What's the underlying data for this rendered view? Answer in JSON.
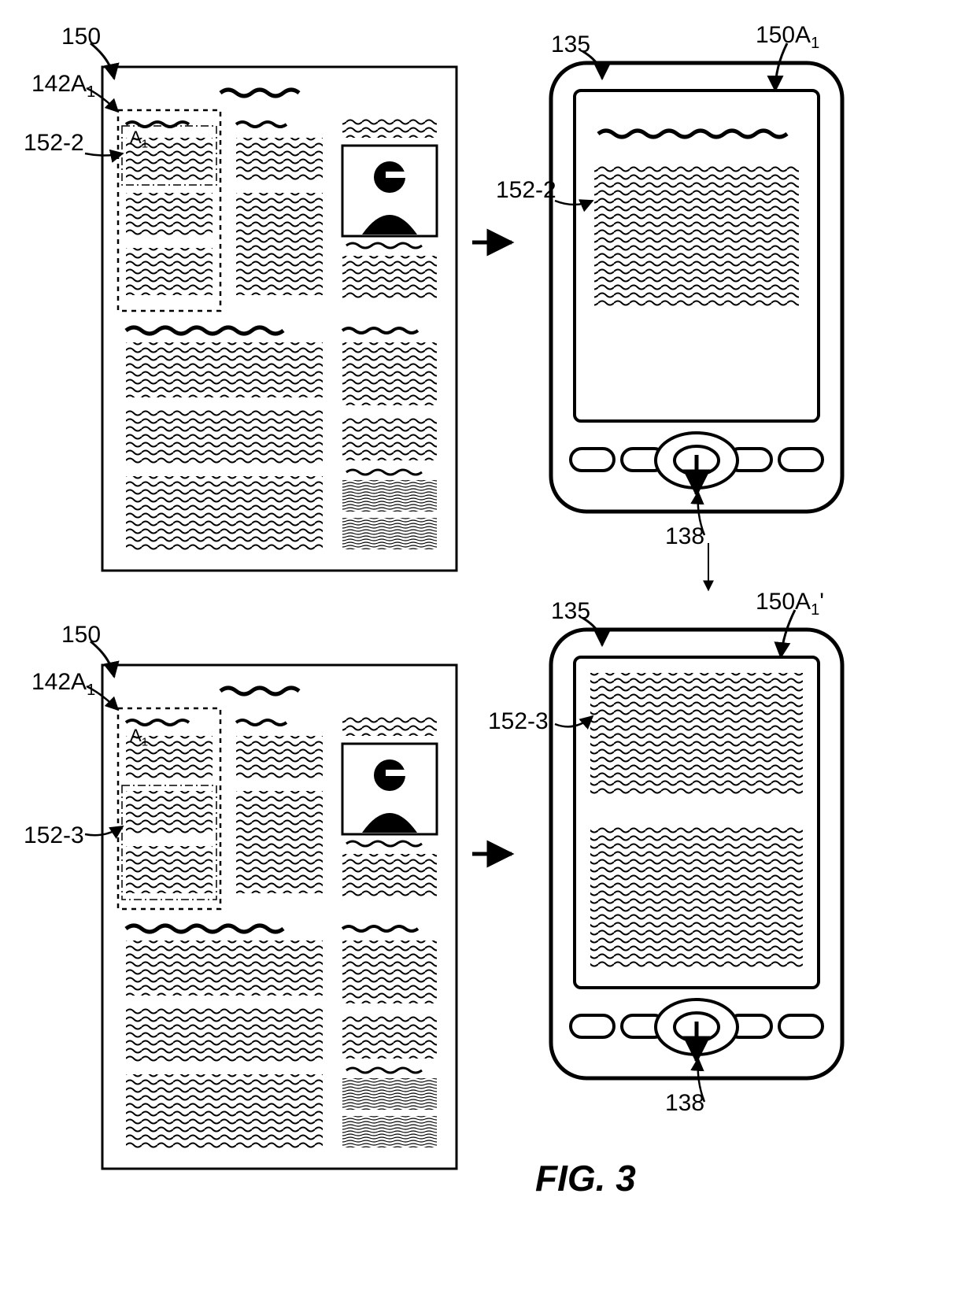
{
  "figure_label": "FIG. 3",
  "refs": {
    "r150_top": "150",
    "r142A1_top": "142A",
    "r152_2_left": "152-2",
    "r135_top": "135",
    "r150A1_top": "150A",
    "r152_2_right": "152-2",
    "r138_top": "138",
    "r150_bot": "150",
    "r142A1_bot": "142A",
    "r152_3_left": "152-3",
    "r135_bot": "135",
    "r150A1_bot": "150A",
    "r152_3_right": "152-3",
    "r138_bot": "138",
    "a1_top": "A",
    "a1_bot": "A"
  }
}
